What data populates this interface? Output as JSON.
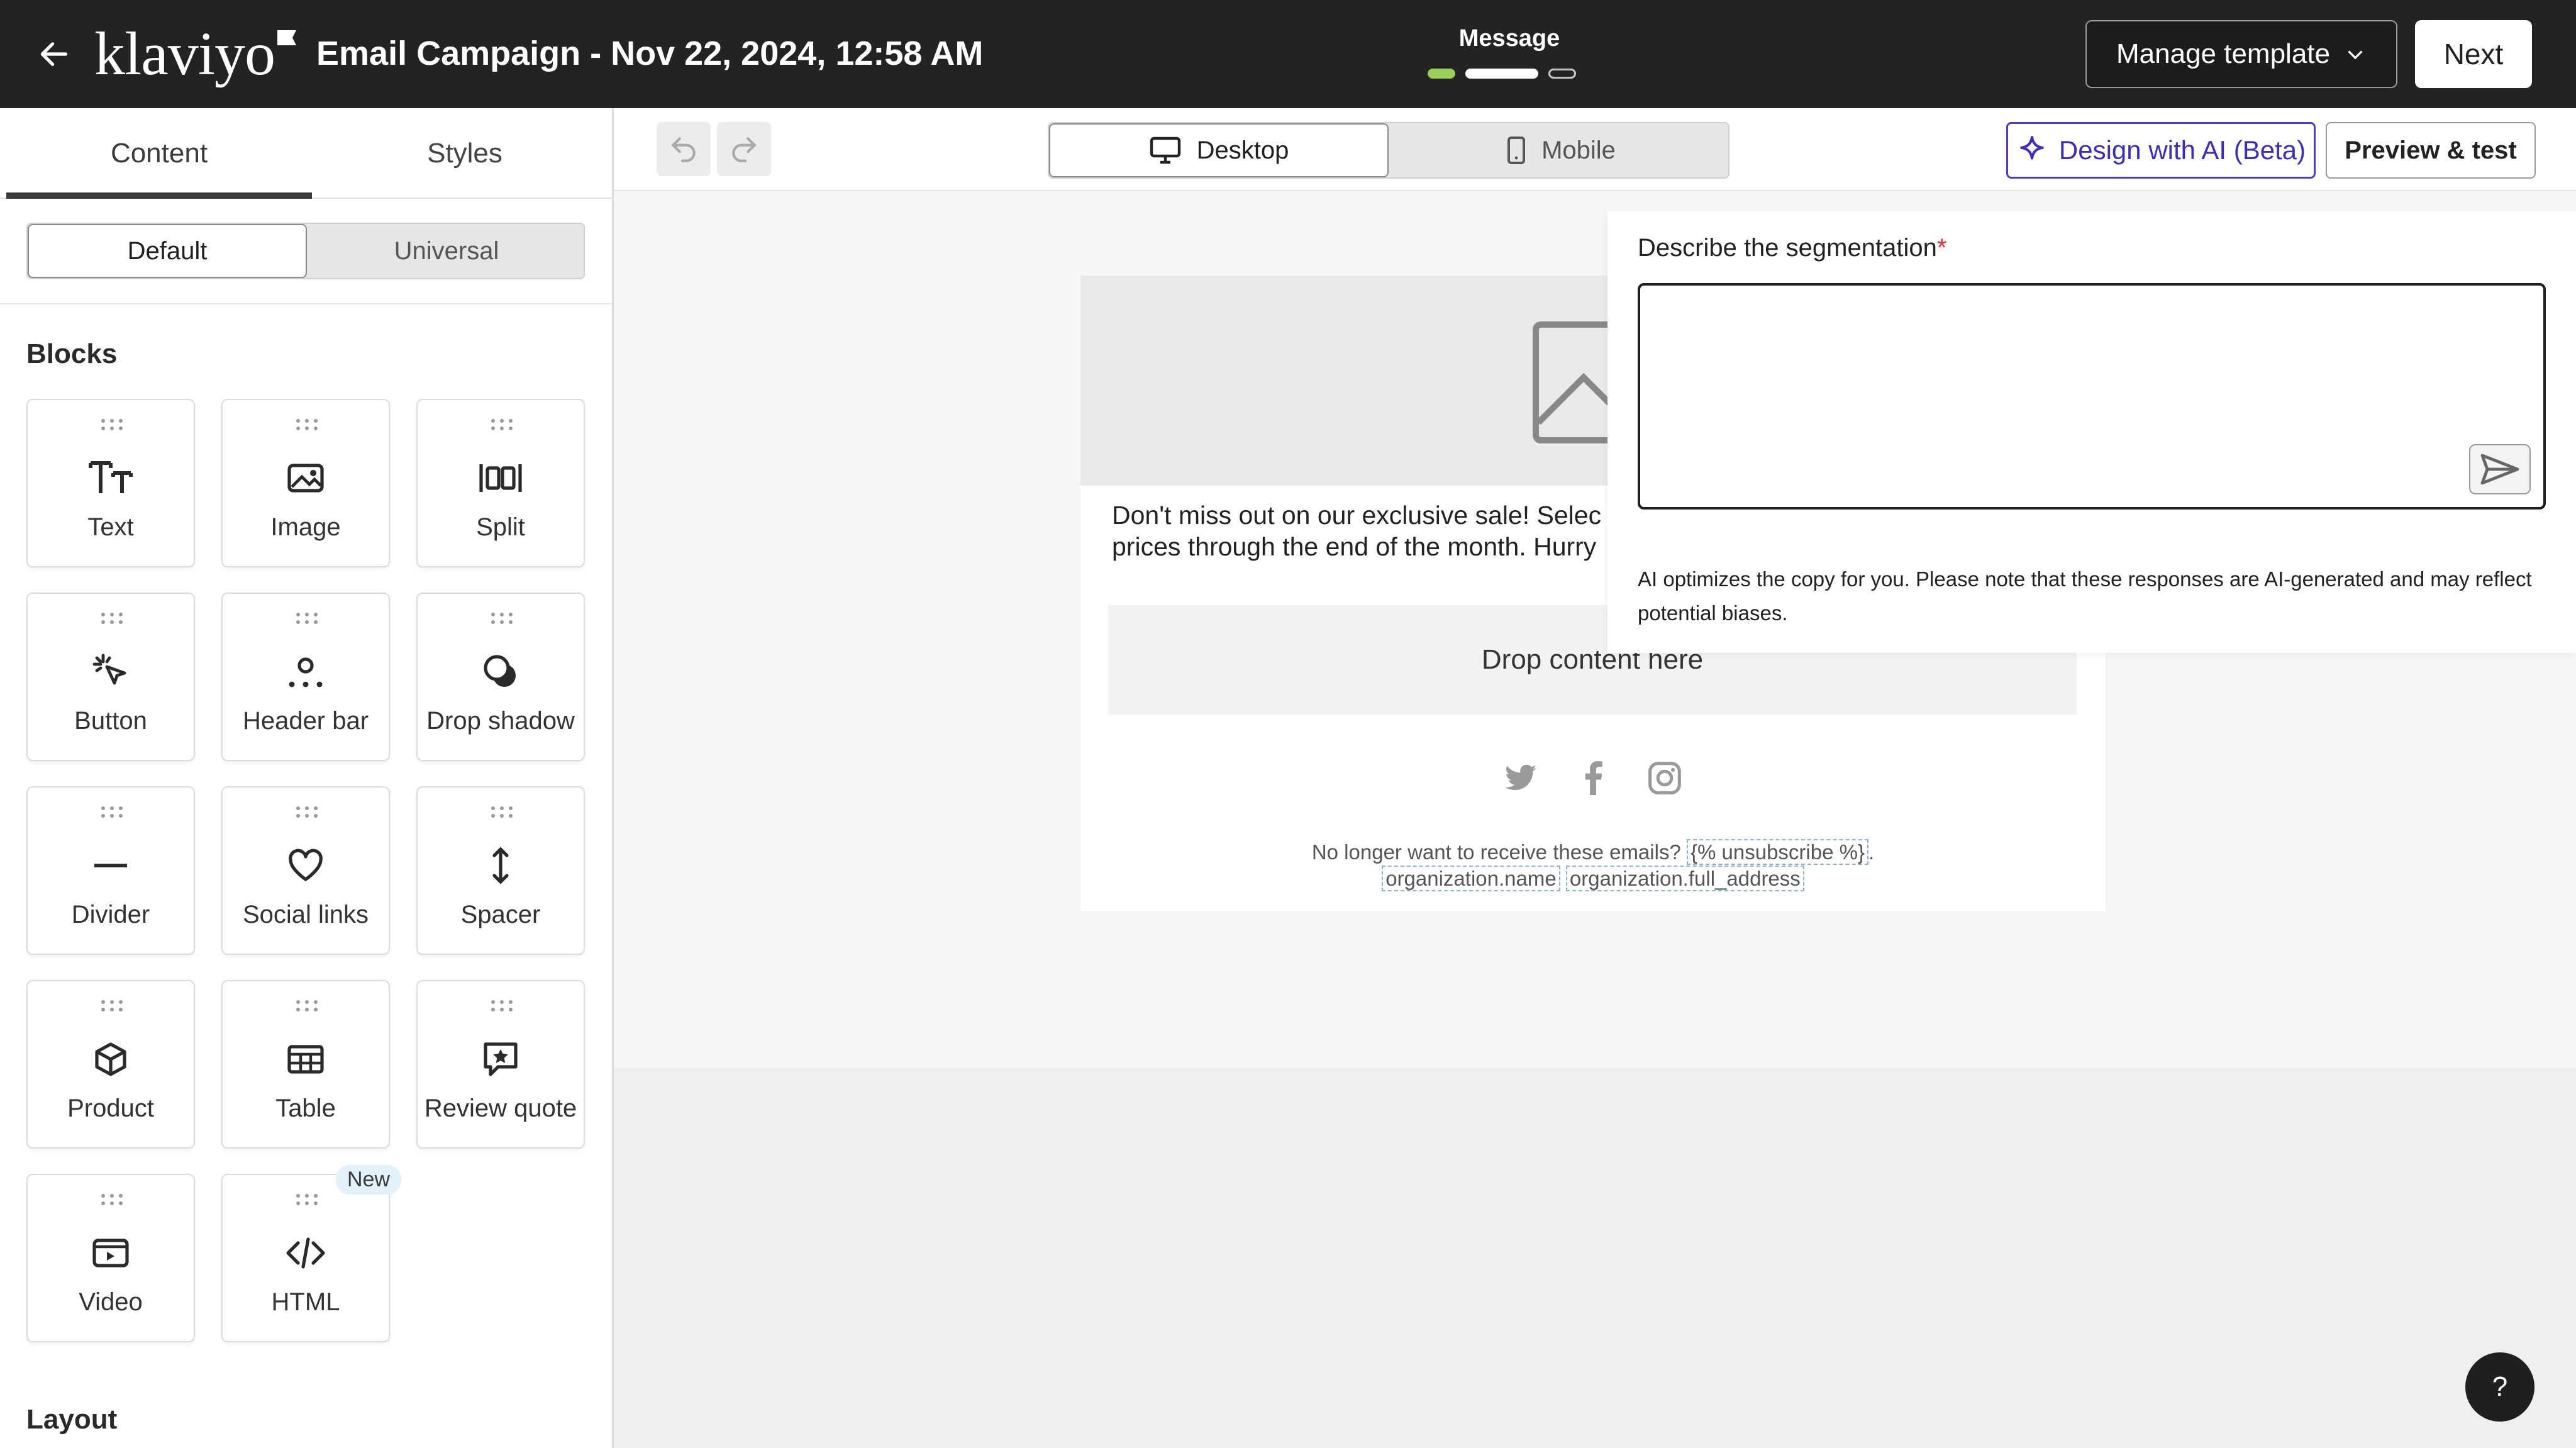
{
  "header": {
    "logo_text": "klaviyo",
    "campaign_title": "Email Campaign - Nov 22, 2024, 12:58 AM",
    "step_label": "Message",
    "manage_template_label": "Manage template",
    "next_label": "Next"
  },
  "sidebar": {
    "tabs": [
      "Content",
      "Styles"
    ],
    "toggle": [
      "Default",
      "Universal"
    ],
    "blocks_title": "Blocks",
    "blocks": [
      {
        "label": "Text",
        "icon": "text-icon"
      },
      {
        "label": "Image",
        "icon": "image-icon"
      },
      {
        "label": "Split",
        "icon": "split-icon"
      },
      {
        "label": "Button",
        "icon": "button-cursor-icon"
      },
      {
        "label": "Header bar",
        "icon": "header-bar-icon"
      },
      {
        "label": "Drop shadow",
        "icon": "drop-shadow-icon"
      },
      {
        "label": "Divider",
        "icon": "divider-icon"
      },
      {
        "label": "Social links",
        "icon": "heart-icon"
      },
      {
        "label": "Spacer",
        "icon": "spacer-icon"
      },
      {
        "label": "Product",
        "icon": "product-box-icon"
      },
      {
        "label": "Table",
        "icon": "table-icon"
      },
      {
        "label": "Review quote",
        "icon": "review-quote-icon"
      },
      {
        "label": "Video",
        "icon": "video-icon"
      },
      {
        "label": "HTML",
        "icon": "html-code-icon",
        "badge": "New"
      }
    ],
    "layout_title": "Layout"
  },
  "toolbar": {
    "devices": [
      "Desktop",
      "Mobile"
    ],
    "ai_label": "Design with AI (Beta)",
    "preview_label": "Preview & test"
  },
  "email": {
    "body_text": "Don't miss out on our exclusive sale! Selec\nprices through the end of the month. Hurry",
    "drop_label": "Drop content here",
    "footer_line1": "No longer want to receive these emails?",
    "footer_unsubscribe": "{% unsubscribe %}",
    "footer_org_name": "organization.name",
    "footer_org_address": "organization.full_address"
  },
  "ai_panel": {
    "label": "Describe the segmentation",
    "required_mark": "*",
    "note": "AI optimizes the copy for you. Please note that these responses are AI-generated and may reflect potential biases."
  },
  "help": {
    "label": "?"
  },
  "colors": {
    "accent_ai": "#4b3ec5",
    "topbar": "#232323",
    "progress_green": "#9acd5a"
  }
}
